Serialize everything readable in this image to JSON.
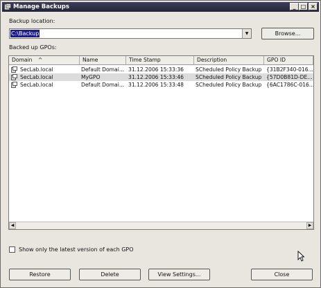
{
  "window": {
    "title": "Manage Backups",
    "controls": {
      "minimize": "_",
      "maximize": "□",
      "close": "×"
    }
  },
  "backup_location": {
    "label": "Backup location:",
    "value": "C:\\Backup",
    "browse_label": "Browse..."
  },
  "backed_up_label": "Backed up GPOs:",
  "table": {
    "columns": [
      "Domain",
      "Name",
      "Time Stamp",
      "Description",
      "GPO ID"
    ],
    "sort_indicator": "^",
    "rows": [
      {
        "domain": "SecLab.local",
        "name": "Default Domai...",
        "timestamp": "31.12.2006 15:33:36",
        "description": "SCheduled Policy Backup",
        "gpo_id": "{31B2F340-016..."
      },
      {
        "domain": "SecLab.local",
        "name": "MyGPO",
        "timestamp": "31.12.2006 15:33:46",
        "description": "SCheduled Policy Backup",
        "gpo_id": "{57D0B81D-DE..."
      },
      {
        "domain": "SecLab.local",
        "name": "Default Domai...",
        "timestamp": "31.12.2006 15:33:48",
        "description": "SCheduled Policy Backup",
        "gpo_id": "{6AC1786C-016..."
      }
    ],
    "selected_row": 1
  },
  "checkbox": {
    "label": "Show only the latest version of each GPO",
    "checked": false
  },
  "buttons": {
    "restore": "Restore",
    "delete": "Delete",
    "view_settings": "View Settings...",
    "close": "Close"
  },
  "icons": {
    "title_icon": "gpo-backup-icon",
    "row_icon": "gpo-icon",
    "dropdown": "chevron-down-icon",
    "scroll_left": "scroll-left-icon",
    "scroll_right": "scroll-right-icon",
    "cursor": "mouse-pointer-icon"
  },
  "colors": {
    "title_bar": "#2b2b42",
    "selection": "#1b1b8a",
    "selected_row": "#dcdcdc"
  }
}
